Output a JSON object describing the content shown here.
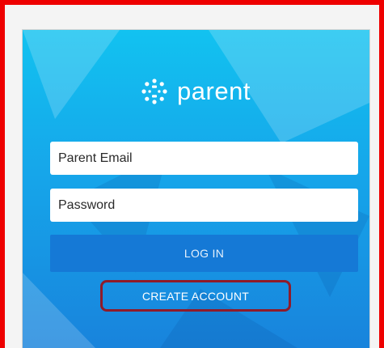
{
  "app": {
    "logo_text": "parent",
    "logo_icon": "canvas-dots-icon"
  },
  "login_form": {
    "email_placeholder": "Parent Email",
    "password_placeholder": "Password",
    "login_label": "LOG IN",
    "create_account_label": "CREATE ACCOUNT"
  },
  "colors": {
    "highlight_border": "#ee0000",
    "gradient_top": "#12c2f0",
    "gradient_bottom": "#1883dc",
    "login_button": "#1579d6",
    "create_account_outline": "#8f1b2a"
  }
}
